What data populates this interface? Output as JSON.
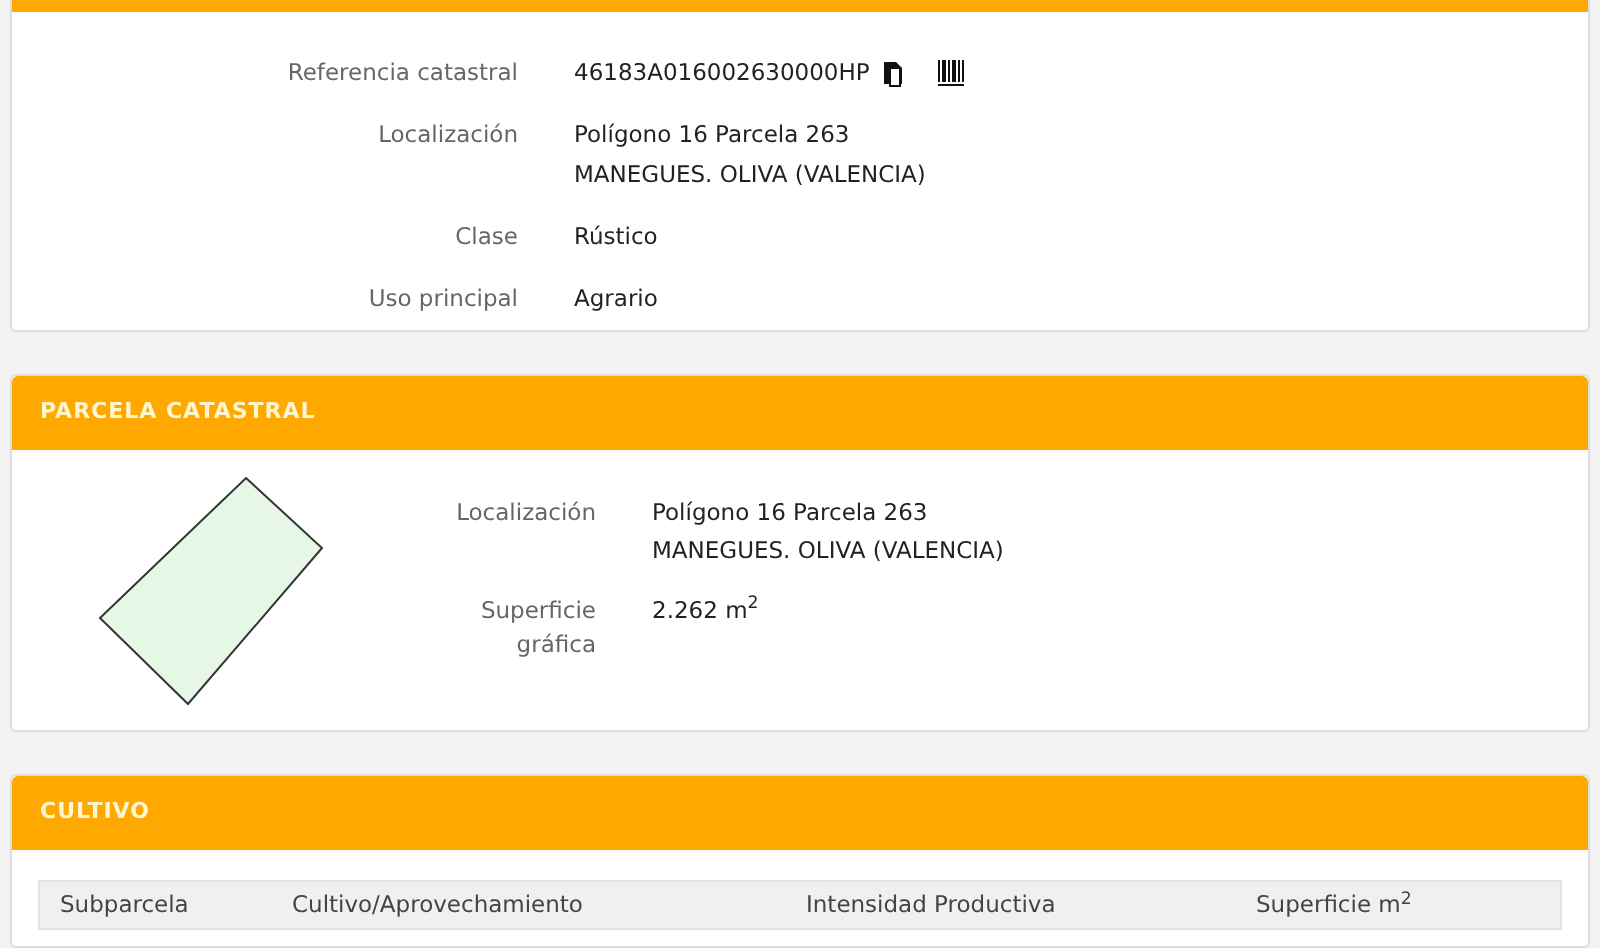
{
  "inmueble": {
    "rows": [
      {
        "label": "Referencia catastral",
        "lines": [
          "46183A016002630000HP"
        ],
        "kind": "reference"
      },
      {
        "label": "Localización",
        "lines": [
          "Polígono 16 Parcela 263",
          "MANEGUES. OLIVA (VALENCIA)"
        ],
        "kind": "text"
      },
      {
        "label": "Clase",
        "lines": [
          "Rústico"
        ],
        "kind": "text"
      },
      {
        "label": "Uso principal",
        "lines": [
          "Agrario"
        ],
        "kind": "text"
      }
    ]
  },
  "parcela": {
    "title": "PARCELA CATASTRAL",
    "rows": [
      {
        "label": "Localización",
        "lines": [
          "Polígono 16 Parcela 263",
          "MANEGUES. OLIVA (VALENCIA)"
        ]
      },
      {
        "label": "Superficie gráfica",
        "lines": [
          "2.262 m$^{2}$"
        ]
      }
    ]
  },
  "cultivo": {
    "title": "CULTIVO",
    "columns": [
      "Subparcela",
      "Cultivo/Aprovechamiento",
      "Intensidad Productiva",
      "Superficie m$^{2}$"
    ]
  }
}
